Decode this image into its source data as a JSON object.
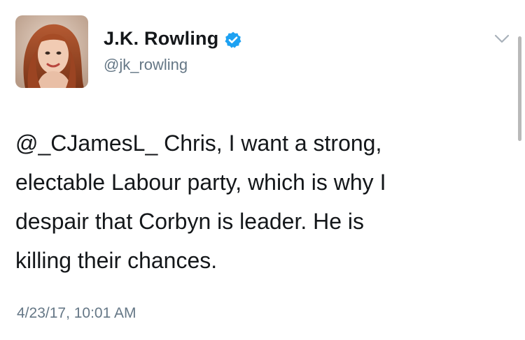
{
  "tweet": {
    "author": {
      "display_name": "J.K. Rowling",
      "handle": "@jk_rowling",
      "verified": true,
      "verified_color": "#1da1f2"
    },
    "text_lines": [
      "@_CJamesL_ Chris, I want a strong,",
      "electable Labour party, which is why I",
      "despair that Corbyn is leader. He is",
      "killing their chances."
    ],
    "timestamp": "4/23/17, 10:01 AM"
  },
  "icons": {
    "verified": "verified-badge-icon",
    "menu": "chevron-down-icon"
  }
}
